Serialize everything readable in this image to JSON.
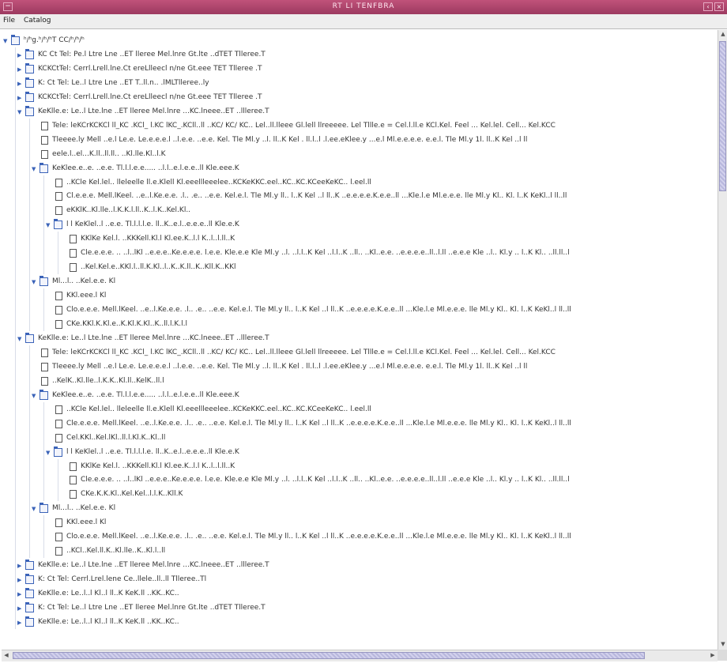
{
  "window": {
    "title": "RT LI TENFBRA",
    "sys_glyph": "−",
    "min_glyph": "‹",
    "close_glyph": "×"
  },
  "menubar": {
    "items": [
      "File",
      "Catalog"
    ]
  },
  "tree": {
    "rows": [
      {
        "depth": 0,
        "type": "folder",
        "expanded": true,
        "label": "ʰ/ʰg.ʰ/ʰ/ʰT  CC/ʰ/ʰ/ʰ"
      },
      {
        "depth": 1,
        "type": "folder",
        "expanded": false,
        "label": "KC Ct Tel: Pe.l Ltre Lne ..ET lleree Mel.lnre Gt.lte ..dTET Tlleree.T"
      },
      {
        "depth": 1,
        "type": "folder",
        "expanded": false,
        "label": "KCKCtTel: Cerrl.Lrell.lne.Ct ereLlleecl n/ne Gt.eee TET Tlleree .T"
      },
      {
        "depth": 1,
        "type": "folder",
        "expanded": false,
        "label": "K: Ct Tel: Le..l Ltre Lne ..ET T..ll.n.. .lMLTlleree..ly"
      },
      {
        "depth": 1,
        "type": "folder",
        "expanded": false,
        "label": "KCKCtTel: Cerrl.Lrell.lne.Ct ereLlleecl n/ne Gt.eee TET Tlleree .T"
      },
      {
        "depth": 1,
        "type": "folder",
        "expanded": true,
        "label": "KeKlle.e: Le..l Lte.lne ..ET lleree Mel.lnre ...KC.lneee..ET ..llleree.T"
      },
      {
        "depth": 2,
        "type": "doc",
        "label": "Tele: leKCrKCKCl ll_KC .KCl_ l.KC lKC_.KCll..ll ..KC/ KC/ KC.. Lel..ll.lleee Gl.lell llreeeee. Lel Tllle.e = Cel.l.ll.e KCl.Kel. Feel ... Kel.lel. Cell... Kel.KCC"
      },
      {
        "depth": 2,
        "type": "doc",
        "label": "Tleeee.ly Mell ..e.l Le.e. Le.e.e.e.l ..l.e.e. ..e.e. Kel. Tle Ml.y ..l. ll..K Kel . ll.l..l .l.ee.eKlee.y ...e.l Ml.e.e.e.e. e.e.l. Tle Ml.y 1l. ll..K Kel ..l ll"
      },
      {
        "depth": 2,
        "type": "doc",
        "label": "eele.l..el...K.ll..ll.ll.. ..Kl.lle.Kl..l.K"
      },
      {
        "depth": 2,
        "type": "folder",
        "expanded": true,
        "label": "KeKlee.e..e. ..e.e. Tl.l.l.e.e..... ..l.l..e.l.e.e..ll Kle.eee.K"
      },
      {
        "depth": 3,
        "type": "doc",
        "label": "..KCle Kel.lel.. lleleelle ll.e.Klell Kl.eeellleeelee..KCKeKKC.eel..KC..KC.KCeeKeKC.. l.eel.ll"
      },
      {
        "depth": 3,
        "type": "doc",
        "label": "Cl.e.e.e. Mell.lKeel. ..e..l.Ke.e.e. .l.. .e.. ..e.e. Kel.e.l. Tle Ml.y ll.. l..K Kel ..l ll..K ..e.e.e.e.K.e.e..ll ...Kle.l.e Ml.e.e.e. lle Ml.y Kl.. Kl. l..K KeKl..l ll..ll"
      },
      {
        "depth": 3,
        "type": "doc",
        "label": "eKKlK..Kl.lle..l.K.K.l.ll..K..l.K..Kel.Kl.."
      },
      {
        "depth": 3,
        "type": "folder",
        "expanded": true,
        "label": "l l KeKlel..l ..e.e. Tl.l.l.l.e. ll..K..e.l..e.e.e..ll Kle.e.K"
      },
      {
        "depth": 4,
        "type": "doc",
        "label": "KKlKe Kel.l. ..KKKell.Kl.l Kl.ee.K..l.l K..l..l.ll..K"
      },
      {
        "depth": 4,
        "type": "doc",
        "label": "Cle.e.e.e. .. ..l..lKl ..e.e.e..Ke.e.e.e. l.e.e. Kle.e.e Kle Ml.y ..l. ..l.l..K Kel ..l.l..K ..ll.. ..Kl..e.e. ..e.e.e.e..ll..l.ll ..e.e.e Kle ..l.. Kl.y .. l..K Kl.. ..ll.ll..l"
      },
      {
        "depth": 4,
        "type": "doc",
        "label": "..Kel.Kel.e..KKl.l..ll.K.Kl..l..K..K.ll..K..Kll.K..KKl"
      },
      {
        "depth": 2,
        "type": "folder",
        "expanded": true,
        "label": "Ml...l.. ..Kel.e.e. Kl"
      },
      {
        "depth": 3,
        "type": "doc",
        "label": "KKl.eee.l Kl"
      },
      {
        "depth": 3,
        "type": "doc",
        "label": "Clo.e.e.e. Mell.lKeel. ..e..l.Ke.e.e. .l.. .e.. ..e.e. Kel.e.l. Tle Ml.y ll.. l..K Kel ..l ll..K ..e.e.e.e.K.e.e..ll ...Kle.l.e Ml.e.e.e. lle Ml.y Kl.. Kl. l..K KeKl..l ll..ll"
      },
      {
        "depth": 3,
        "type": "doc",
        "label": "CKe.KKl.K.Kl.e..K.Kl.K.Kl..K..ll.l.K.l.l"
      },
      {
        "depth": 1,
        "type": "folder",
        "expanded": true,
        "label": "KeKlle.e: Le..l Lte.lne ..ET lleree Mel.lnre ...KC.lneee..ET ..llleree.T"
      },
      {
        "depth": 2,
        "type": "doc",
        "label": "Tele: leKCrKCKCl ll_KC .KCl_ l.KC lKC_.KCll..ll ..KC/ KC/ KC.. Lel..ll.lleee Gl.lell llreeeee. Lel Tllle.e = Cel.l.ll.e KCl.Kel. Feel ... Kel.lel. Cell... Kel.KCC"
      },
      {
        "depth": 2,
        "type": "doc",
        "label": "Tleeee.ly Mell ..e.l Le.e. Le.e.e.e.l ..l.e.e. ..e.e. Kel. Tle Ml.y ..l. ll..K Kel . ll.l..l .l.ee.eKlee.y ...e.l Ml.e.e.e.e. e.e.l. Tle Ml.y 1l. ll..K Kel ..l ll"
      },
      {
        "depth": 2,
        "type": "doc",
        "label": "..KelK..Kl.lle..l.K.K..Kl.ll..KelK..ll.l"
      },
      {
        "depth": 2,
        "type": "folder",
        "expanded": true,
        "label": "KeKlee.e..e. ..e.e. Tl.l.l.e.e..... ..l.l..e.l.e.e..ll Kle.eee.K"
      },
      {
        "depth": 3,
        "type": "doc",
        "label": "..KCle Kel.lel.. lleleelle ll.e.Klell Kl.eeellleeelee..KCKeKKC.eel..KC..KC.KCeeKeKC.. l.eel.ll"
      },
      {
        "depth": 3,
        "type": "doc",
        "label": "Cle.e.e.e. Mell.lKeel. ..e..l.Ke.e.e. .l.. .e.. ..e.e. Kel.e.l. Tle Ml.y ll.. l..K Kel ..l ll..K ..e.e.e.e.K.e.e..ll ...Kle.l.e Ml.e.e.e. lle Ml.y Kl.. Kl. l..K KeKl..l ll..ll"
      },
      {
        "depth": 3,
        "type": "doc",
        "label": "Cel.KKl..Kel.lKl..ll.l.Kl.K..Kl..ll"
      },
      {
        "depth": 3,
        "type": "folder",
        "expanded": true,
        "label": "l l KeKlel..l ..e.e. Tl.l.l.l.e. ll..K..e.l..e.e.e..ll Kle.e.K"
      },
      {
        "depth": 4,
        "type": "doc",
        "label": "KKlKe Kel.l. ..KKKell.Kl.l Kl.ee.K..l.l K..l..l.ll..K"
      },
      {
        "depth": 4,
        "type": "doc",
        "label": "Cle.e.e.e. .. ..l..lKl ..e.e.e..Ke.e.e.e. l.e.e. Kle.e.e Kle Ml.y ..l. ..l.l..K Kel ..l.l..K ..ll.. ..Kl..e.e. ..e.e.e.e..ll..l.ll ..e.e.e Kle ..l.. Kl.y .. l..K Kl.. ..ll.ll..l"
      },
      {
        "depth": 4,
        "type": "doc",
        "label": "CKe.K.K.Kl..Kel.Kel..l.l.K..Kll.K"
      },
      {
        "depth": 2,
        "type": "folder",
        "expanded": true,
        "label": "Ml...l.. ..Kel.e.e. Kl"
      },
      {
        "depth": 3,
        "type": "doc",
        "label": "KKl.eee.l Kl"
      },
      {
        "depth": 3,
        "type": "doc",
        "label": "Clo.e.e.e. Mell.lKeel. ..e..l.Ke.e.e. .l.. .e.. ..e.e. Kel.e.l. Tle Ml.y ll.. l..K Kel ..l ll..K ..e.e.e.e.K.e.e..ll ...Kle.l.e Ml.e.e.e. lle Ml.y Kl.. Kl. l..K KeKl..l ll..ll"
      },
      {
        "depth": 3,
        "type": "doc",
        "label": "..KCl..Kel.ll.K..Kl.lle..K..Kl.l..ll"
      },
      {
        "depth": 1,
        "type": "folder",
        "expanded": false,
        "label": "KeKlle.e: Le..l Lte.lne ..ET lleree Mel.lnre ...KC.lneee..ET ..llleree.T"
      },
      {
        "depth": 1,
        "type": "folder",
        "expanded": false,
        "label": "K: Ct Tel: Cerrl.Lrel.lene Ce..llele..ll..ll Tlleree..Tl"
      },
      {
        "depth": 1,
        "type": "folder",
        "expanded": false,
        "label": "KeKlle.e: Le..l..l Kl..l ll..K KeK.ll ..KK..KC.."
      },
      {
        "depth": 1,
        "type": "folder",
        "expanded": false,
        "label": "K: Ct Tel: Le..l Ltre Lne ..ET lleree Mel.lnre Gt.lte ..dTET Tlleree.T"
      },
      {
        "depth": 1,
        "type": "folder",
        "expanded": false,
        "label": "KeKlle.e: Le..l..l Kl..l ll..K KeK.ll ..KK..KC.."
      }
    ]
  },
  "scroll": {
    "up": "▲",
    "down": "▼",
    "left": "◀",
    "right": "▶"
  }
}
